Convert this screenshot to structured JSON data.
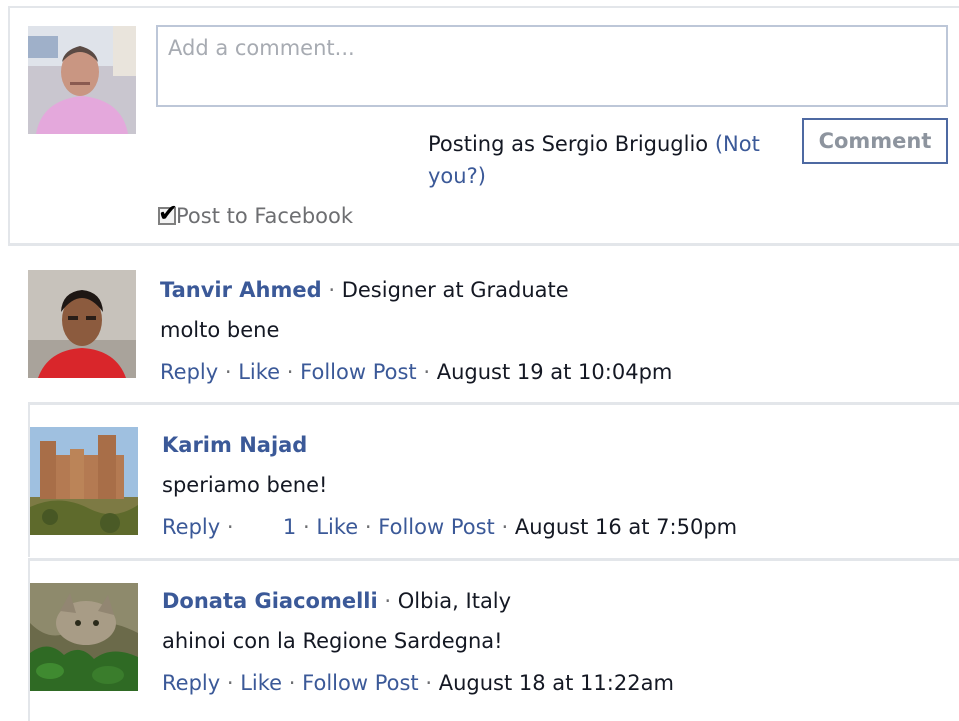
{
  "composer": {
    "placeholder": "Add a comment...",
    "posting_as_prefix": "Posting as Sergio Briguglio",
    "not_you_link": "(Not you?)",
    "comment_button": "Comment",
    "post_to_facebook_label": "Post to Facebook",
    "post_to_facebook_checked": true
  },
  "separator": "·",
  "comments": [
    {
      "author": "Tanvir Ahmed",
      "subtitle": "Designer at Graduate",
      "text": "molto bene",
      "reply": "Reply",
      "like": "Like",
      "follow": "Follow Post",
      "timestamp": "August 19 at 10:04pm",
      "like_count": ""
    },
    {
      "author": "Karim Najad",
      "subtitle": "",
      "text": "speriamo bene!",
      "reply": "Reply",
      "like": "Like",
      "follow": "Follow Post",
      "timestamp": "August 16 at 7:50pm",
      "like_count": "1"
    },
    {
      "author": "Donata Giacomelli",
      "subtitle": "Olbia, Italy",
      "text": "ahinoi con la Regione Sardegna!",
      "reply": "Reply",
      "like": "Like",
      "follow": "Follow Post",
      "timestamp": "August 18 at 11:22am",
      "like_count": ""
    }
  ],
  "colors": {
    "link": "#3b5998",
    "text": "#141823",
    "border": "#e3e6ea",
    "input_border": "#bdc7d8"
  }
}
